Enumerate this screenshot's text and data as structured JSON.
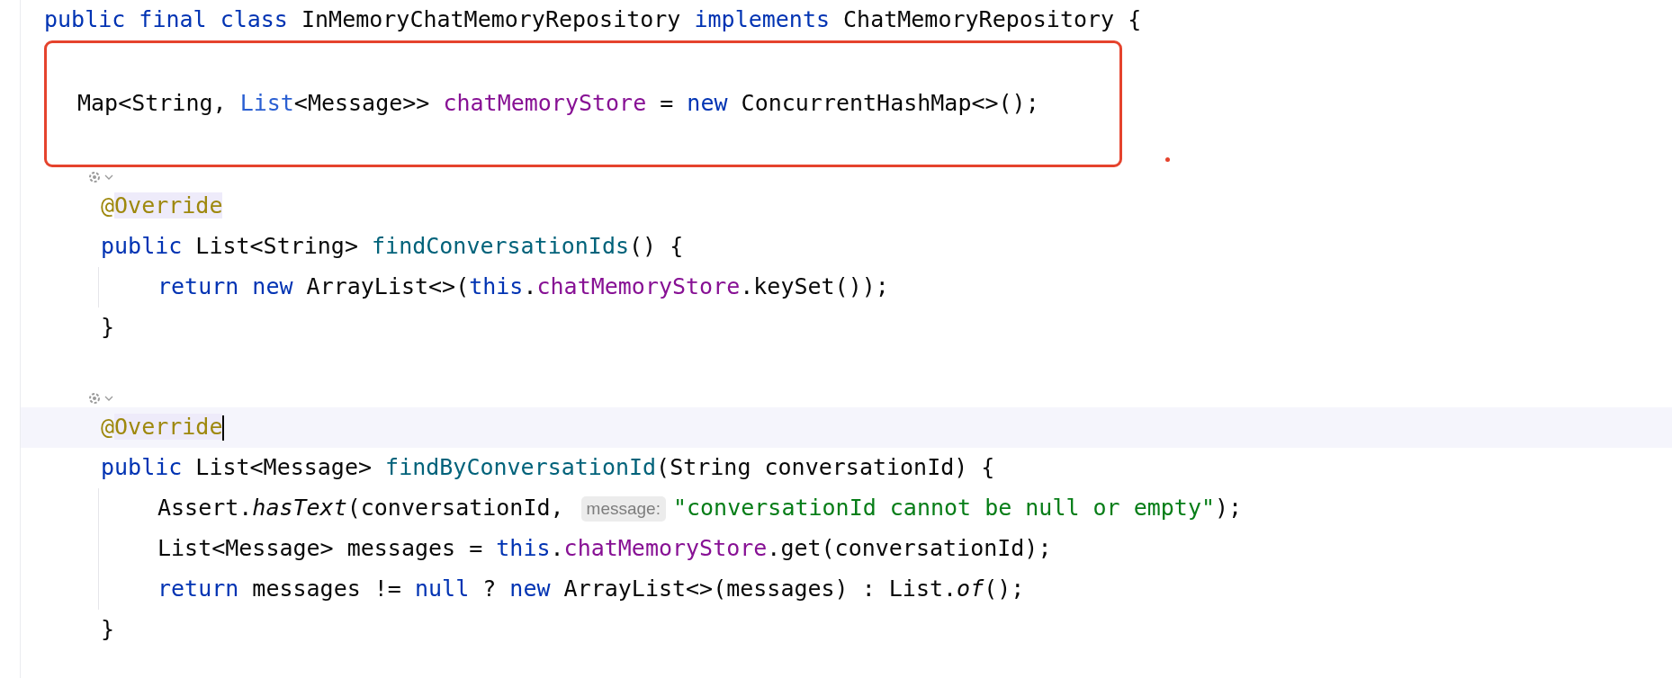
{
  "editor": {
    "lines": [
      {
        "kind": "code",
        "tokens": [
          {
            "kind": "keyword",
            "text": "public final class "
          },
          {
            "kind": "plain",
            "text": "InMemoryChatMemoryRepository "
          },
          {
            "kind": "keyword",
            "text": "implements "
          },
          {
            "kind": "plain",
            "text": "ChatMemoryRepository {"
          }
        ],
        "children": [
          {
            "kind": "blank",
            "boxed": true
          },
          {
            "kind": "code",
            "boxed": true,
            "tokens": [
              {
                "kind": "plain",
                "text": "Map<String, "
              },
              {
                "kind": "type-ref",
                "text": "List"
              },
              {
                "kind": "plain",
                "text": "<Message>> "
              },
              {
                "kind": "field",
                "text": "chatMemoryStore"
              },
              {
                "kind": "plain",
                "text": " = "
              },
              {
                "kind": "keyword",
                "text": "new "
              },
              {
                "kind": "plain",
                "text": "ConcurrentHashMap<>();"
              }
            ]
          },
          {
            "kind": "blank",
            "boxed": true
          },
          {
            "kind": "marker"
          },
          {
            "kind": "code",
            "current": false,
            "tokens": [
              {
                "kind": "annotation",
                "text": "@"
              },
              {
                "kind": "annotation-name",
                "text": "Override"
              }
            ]
          },
          {
            "kind": "code",
            "tokens": [
              {
                "kind": "keyword",
                "text": "public "
              },
              {
                "kind": "plain",
                "text": "List<String> "
              },
              {
                "kind": "method",
                "text": "findConversationIds"
              },
              {
                "kind": "plain",
                "text": "() {"
              }
            ],
            "children": [
              {
                "kind": "code",
                "tokens": [
                  {
                    "kind": "keyword",
                    "text": "return new "
                  },
                  {
                    "kind": "plain",
                    "text": "ArrayList<>("
                  },
                  {
                    "kind": "keyword",
                    "text": "this"
                  },
                  {
                    "kind": "plain",
                    "text": "."
                  },
                  {
                    "kind": "field",
                    "text": "chatMemoryStore"
                  },
                  {
                    "kind": "plain",
                    "text": ".keySet());"
                  }
                ]
              }
            ]
          },
          {
            "kind": "code",
            "tokens": [
              {
                "kind": "plain",
                "text": "}"
              }
            ]
          },
          {
            "kind": "blank"
          },
          {
            "kind": "marker"
          },
          {
            "kind": "code",
            "current": true,
            "tokens": [
              {
                "kind": "annotation",
                "text": "@"
              },
              {
                "kind": "annotation-name",
                "text": "Override"
              }
            ]
          },
          {
            "kind": "code",
            "tokens": [
              {
                "kind": "keyword",
                "text": "public "
              },
              {
                "kind": "plain",
                "text": "List<Message> "
              },
              {
                "kind": "method",
                "text": "findByConversationId"
              },
              {
                "kind": "plain",
                "text": "(String conversationId) {"
              }
            ],
            "children": [
              {
                "kind": "code",
                "tokens": [
                  {
                    "kind": "plain",
                    "text": "Assert."
                  },
                  {
                    "kind": "static",
                    "text": "hasText"
                  },
                  {
                    "kind": "plain",
                    "text": "(conversationId, "
                  },
                  {
                    "kind": "inlay",
                    "text": "message:"
                  },
                  {
                    "kind": "string",
                    "text": "\"conversationId cannot be null or empty\""
                  },
                  {
                    "kind": "plain",
                    "text": ");"
                  }
                ]
              },
              {
                "kind": "code",
                "tokens": [
                  {
                    "kind": "plain",
                    "text": "List<Message> messages = "
                  },
                  {
                    "kind": "keyword",
                    "text": "this"
                  },
                  {
                    "kind": "plain",
                    "text": "."
                  },
                  {
                    "kind": "field",
                    "text": "chatMemoryStore"
                  },
                  {
                    "kind": "plain",
                    "text": ".get(conversationId);"
                  }
                ]
              },
              {
                "kind": "code",
                "tokens": [
                  {
                    "kind": "keyword",
                    "text": "return "
                  },
                  {
                    "kind": "plain",
                    "text": "messages != "
                  },
                  {
                    "kind": "keyword",
                    "text": "null "
                  },
                  {
                    "kind": "plain",
                    "text": "? "
                  },
                  {
                    "kind": "keyword",
                    "text": "new "
                  },
                  {
                    "kind": "plain",
                    "text": "ArrayList<>(messages) : List."
                  },
                  {
                    "kind": "static",
                    "text": "of"
                  },
                  {
                    "kind": "plain",
                    "text": "();"
                  }
                ]
              }
            ]
          },
          {
            "kind": "code",
            "tokens": [
              {
                "kind": "plain",
                "text": "}"
              }
            ]
          }
        ]
      }
    ]
  }
}
